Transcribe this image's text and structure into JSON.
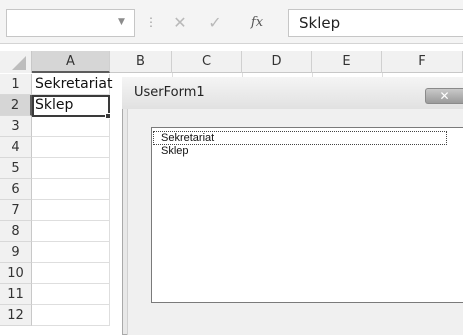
{
  "formula_bar": {
    "name_box": "",
    "cancel_symbol": "✕",
    "enter_symbol": "✓",
    "function_symbol": "fx",
    "formula": "Sklep"
  },
  "columns": [
    "A",
    "B",
    "C",
    "D",
    "E",
    "F"
  ],
  "rows": [
    "1",
    "2",
    "3",
    "4",
    "5",
    "6",
    "7",
    "8",
    "9",
    "10",
    "11",
    "12"
  ],
  "cells": {
    "a1": "Sekretariat",
    "a2": "Sklep"
  },
  "userform": {
    "title": "UserForm1",
    "close_symbol": "✕",
    "listbox_items": [
      "Sekretariat",
      "Sklep"
    ]
  }
}
